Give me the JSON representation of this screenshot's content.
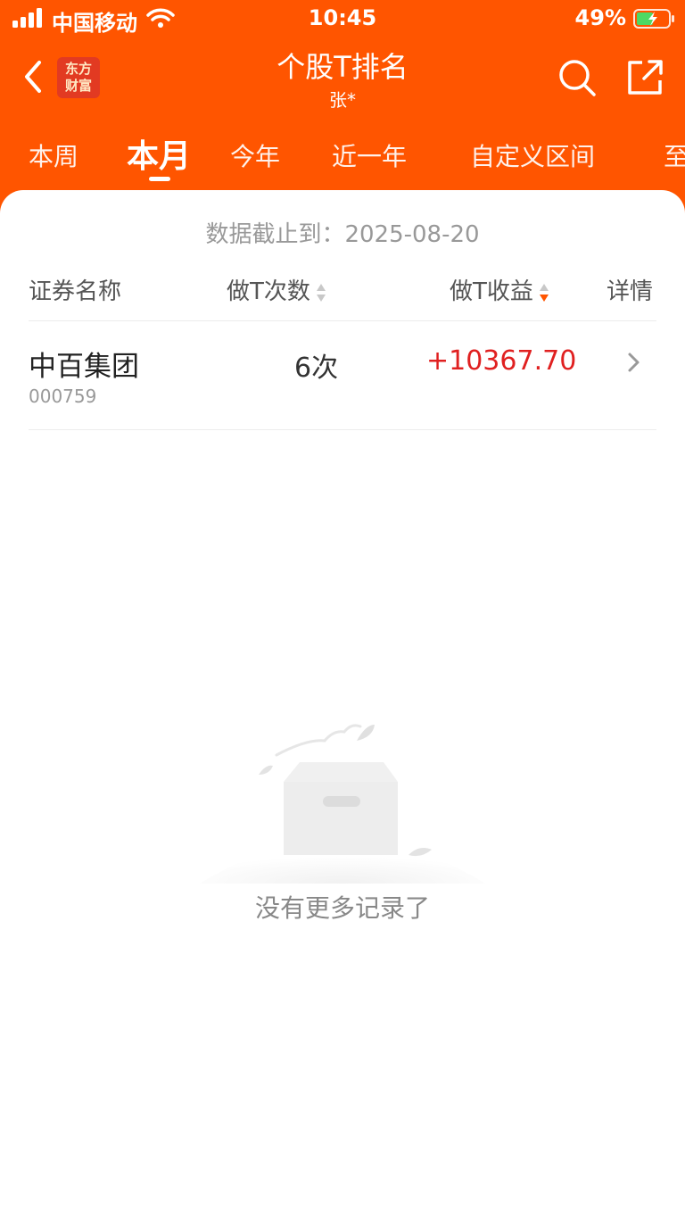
{
  "status_bar": {
    "carrier": "中国移动",
    "time": "10:45",
    "battery": "49%"
  },
  "nav": {
    "logo_line1": "东方",
    "logo_line2": "财富",
    "title": "个股T排名",
    "subtitle": "张*"
  },
  "tabs": [
    {
      "label": "本周",
      "active": false
    },
    {
      "label": "本月",
      "active": true
    },
    {
      "label": "今年",
      "active": false
    },
    {
      "label": "近一年",
      "active": false
    },
    {
      "label": "自定义区间",
      "active": false
    },
    {
      "label": "至",
      "active": false
    }
  ],
  "date_line": "数据截止到：2025-08-20",
  "table": {
    "headers": {
      "name": "证券名称",
      "count": "做T次数",
      "profit": "做T收益",
      "detail": "详情"
    },
    "rows": [
      {
        "name": "中百集团",
        "code": "000759",
        "count": "6次",
        "profit": "+10367.70"
      }
    ]
  },
  "empty_text": "没有更多记录了",
  "colors": {
    "brand": "#ff5500",
    "profit_positive": "#e02020",
    "logo_bg": "#e23a22"
  },
  "icons": [
    "signal-icon",
    "wifi-icon",
    "battery-icon",
    "back-icon",
    "search-icon",
    "share-icon",
    "chevron-right-icon",
    "empty-box-icon"
  ]
}
